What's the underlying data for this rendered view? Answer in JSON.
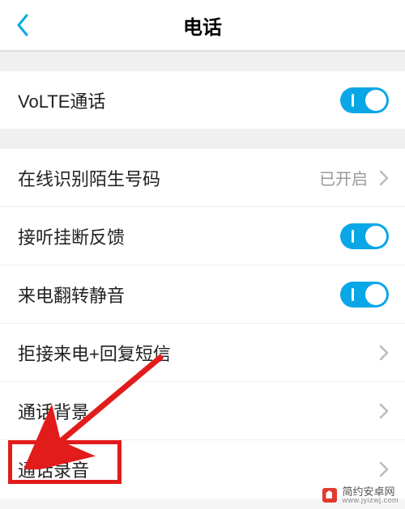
{
  "header": {
    "title": "电话"
  },
  "sections": {
    "volte": {
      "label": "VoLTE通话",
      "on": true
    },
    "unknown_id": {
      "label": "在线识别陌生号码",
      "value": "已开启"
    },
    "answer_feedback": {
      "label": "接听挂断反馈",
      "on": true
    },
    "flip_mute": {
      "label": "来电翻转静音",
      "on": true
    },
    "reject_sms": {
      "label": "拒接来电+回复短信"
    },
    "call_bg": {
      "label": "通话背景"
    },
    "call_record": {
      "label": "通话录音"
    }
  },
  "colors": {
    "accent": "#0aa7e6",
    "annotation": "#e21b1b"
  },
  "watermark": {
    "name": "简约安卓网",
    "url": "www.jyizwj.com"
  }
}
